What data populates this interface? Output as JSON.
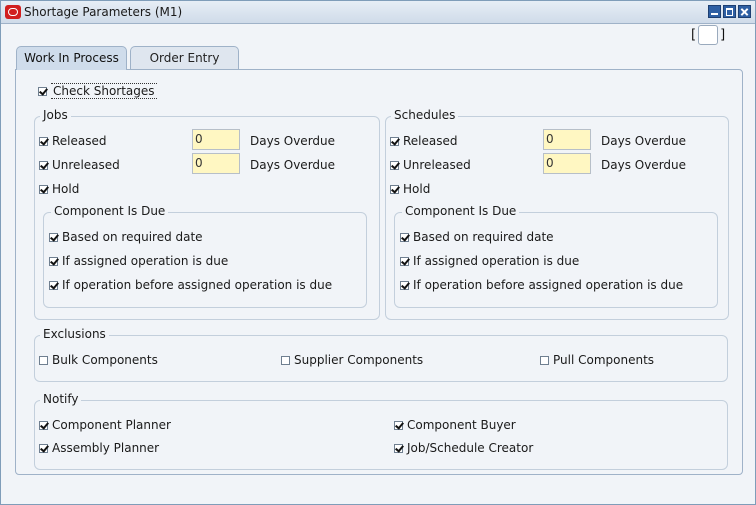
{
  "window": {
    "title": "Shortage Parameters (M1)"
  },
  "bracket": {
    "left": "[",
    "right": "]"
  },
  "tabs": [
    {
      "label": "Work In Process"
    },
    {
      "label": "Order Entry"
    }
  ],
  "check_shortages": {
    "label": "Check Shortages",
    "checked": true
  },
  "jobs": {
    "title": "Jobs",
    "released": {
      "label": "Released",
      "checked": true,
      "days": "0"
    },
    "unreleased": {
      "label": "Unreleased",
      "checked": true,
      "days": "0"
    },
    "hold": {
      "label": "Hold",
      "checked": true
    },
    "days_overdue_label": "Days Overdue",
    "component_due": {
      "title": "Component Is Due",
      "items": [
        {
          "label": "Based on required date",
          "checked": true
        },
        {
          "label": "If assigned operation is due",
          "checked": true
        },
        {
          "label": "If operation before assigned operation is due",
          "checked": true
        }
      ]
    }
  },
  "schedules": {
    "title": "Schedules",
    "released": {
      "label": "Released",
      "checked": true,
      "days": "0"
    },
    "unreleased": {
      "label": "Unreleased",
      "checked": true,
      "days": "0"
    },
    "hold": {
      "label": "Hold",
      "checked": true
    },
    "days_overdue_label": "Days Overdue",
    "component_due": {
      "title": "Component Is Due",
      "items": [
        {
          "label": "Based on required date",
          "checked": true
        },
        {
          "label": "If assigned operation is due",
          "checked": true
        },
        {
          "label": "If operation before assigned operation is due",
          "checked": true
        }
      ]
    }
  },
  "exclusions": {
    "title": "Exclusions",
    "items": [
      {
        "label": "Bulk Components",
        "checked": false
      },
      {
        "label": "Supplier Components",
        "checked": false
      },
      {
        "label": "Pull Components",
        "checked": false
      }
    ]
  },
  "notify": {
    "title": "Notify",
    "items": [
      {
        "label": "Component Planner",
        "checked": true
      },
      {
        "label": "Component Buyer",
        "checked": true
      },
      {
        "label": "Assembly Planner",
        "checked": true
      },
      {
        "label": "Job/Schedule Creator",
        "checked": true
      }
    ]
  }
}
